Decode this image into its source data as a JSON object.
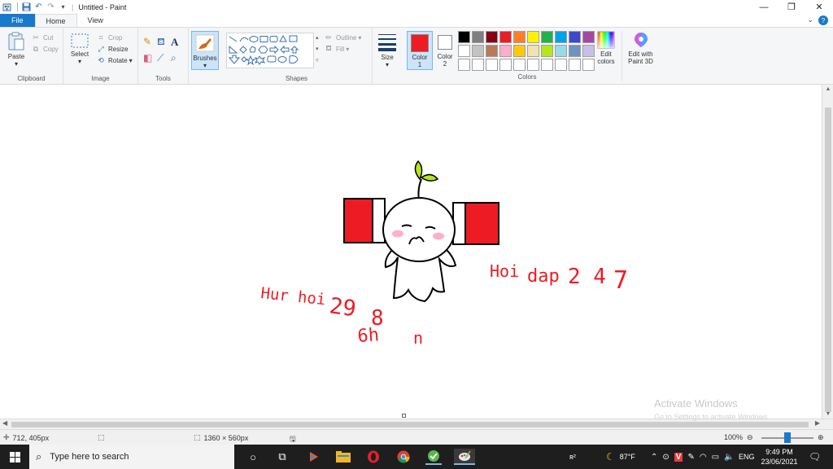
{
  "titlebar": {
    "title": "Untitled - Paint",
    "qat_divider": "|",
    "qat_dropdown": "▾"
  },
  "ribbon": {
    "tabs": {
      "file": "File",
      "home": "Home",
      "view": "View"
    },
    "clipboard": {
      "paste": "Paste",
      "cut": "Cut",
      "copy": "Copy",
      "label": "Clipboard"
    },
    "image": {
      "select": "Select",
      "crop": "Crop",
      "resize": "Resize",
      "rotate": "Rotate",
      "label": "Image"
    },
    "tools": {
      "label": "Tools",
      "text_tool": "A"
    },
    "brushes": {
      "label": "Brushes"
    },
    "shapes": {
      "outline": "Outline",
      "fill": "Fill",
      "label": "Shapes"
    },
    "size": {
      "label": "Size"
    },
    "color1": {
      "label": "Color",
      "num": "1"
    },
    "color2": {
      "label": "Color",
      "num": "2"
    },
    "colors": {
      "label": "Colors",
      "row1": [
        "#000000",
        "#7f7f7f",
        "#880015",
        "#ed1c24",
        "#ff7f27",
        "#fff200",
        "#22b14c",
        "#00a2e8",
        "#3f48cc",
        "#a349a4"
      ],
      "row2": [
        "#ffffff",
        "#c3c3c3",
        "#b97a57",
        "#ffaec9",
        "#ffc90e",
        "#efe4b0",
        "#b5e61d",
        "#99d9ea",
        "#7092be",
        "#c8bfe7"
      ],
      "row3": [
        "#ffffff",
        "#ffffff",
        "#ffffff",
        "#ffffff",
        "#ffffff",
        "#ffffff",
        "#ffffff",
        "#ffffff",
        "#ffffff",
        "#ffffff"
      ]
    },
    "edit_colors": {
      "line1": "Edit",
      "line2": "colors"
    },
    "paint3d": {
      "line1": "Edit with",
      "line2": "Paint 3D"
    }
  },
  "canvas": {
    "text_left_1": "Hur hoi",
    "text_left_2": "29",
    "text_left_3": "8",
    "text_left_4": "6h",
    "text_left_5": "n",
    "text_right_1": "Hoi",
    "text_right_2": "dap",
    "text_right_3": "2 4",
    "text_right_4": "7",
    "stroke_color": "#ed1c24"
  },
  "watermark": {
    "line1": "Activate Windows",
    "line2": "Go to Settings to activate Windows."
  },
  "status": {
    "cursor_pos": "712, 405px",
    "canvas_size": "1360 × 560px",
    "zoom": "100%"
  },
  "taskbar": {
    "search_placeholder": "Type here to search",
    "temperature": "87°F",
    "language": "ENG",
    "time": "9:49 PM",
    "date": "23/06/2021",
    "keyboard_indicator": "ʀ²"
  },
  "colors": {
    "accent": "#1979ca",
    "primary_color": "#ed1c24",
    "secondary_color": "#ffffff"
  }
}
